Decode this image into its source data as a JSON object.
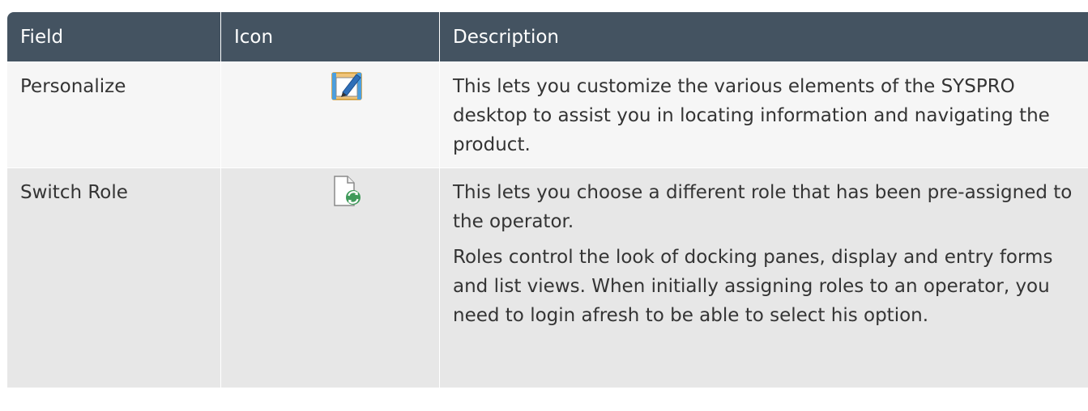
{
  "table": {
    "headers": {
      "field": "Field",
      "icon": "Icon",
      "description": "Description"
    },
    "rows": [
      {
        "field": "Personalize",
        "icon": "personalize-edit-icon",
        "description": [
          "This lets you customize the various elements of the SYSPRO desktop to assist you in locating information and navigating the product."
        ]
      },
      {
        "field": "Switch Role",
        "icon": "switch-role-document-refresh-icon",
        "description": [
          "This lets you choose a different role that has been pre-assigned to the operator.",
          "Roles control the look of docking panes, display and entry forms and list views. When initially assigning roles to an operator, you need to login afresh to be able to select his option."
        ]
      }
    ]
  },
  "colors": {
    "header_bg": "#445361",
    "row_light": "#f6f6f6",
    "row_dark": "#e7e7e7"
  }
}
